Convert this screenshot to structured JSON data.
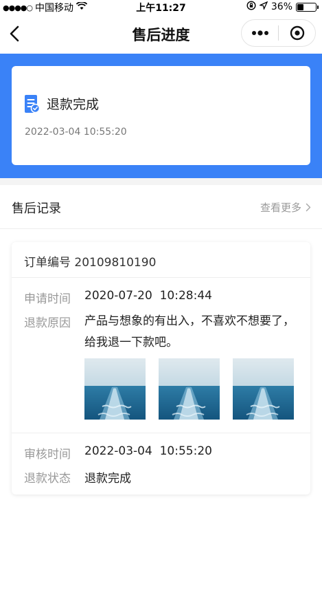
{
  "status_bar": {
    "carrier": "中国移动",
    "time": "上午11:27",
    "battery": "36%",
    "battery_level": 0.36
  },
  "nav": {
    "title": "售后进度",
    "back_icon": "chevron-left-icon",
    "more_icon": "more-dots-icon",
    "close_icon": "target-close-icon"
  },
  "status_card": {
    "status": "退款完成",
    "datetime": "2022-03-04 10:55:20",
    "icon": "document-check-icon"
  },
  "section": {
    "title": "售后记录",
    "more_label": "查看更多"
  },
  "record": {
    "order_label": "订单编号 20109810190",
    "apply_time_label": "申请时间",
    "apply_time": "2020-07-20  10:28:44",
    "reason_label": "退款原因",
    "reason": "产品与想象的有出入，不喜欢不想要了，给我退一下款吧。",
    "review_time_label": "审核时间",
    "review_time": "2022-03-04  10:55:20",
    "refund_status_label": "退款状态",
    "refund_status": "退款完成",
    "images": [
      "sea-photo",
      "sea-photo",
      "sea-photo"
    ]
  },
  "colors": {
    "primary": "#3a82f7",
    "muted": "#999999",
    "text": "#222222"
  }
}
